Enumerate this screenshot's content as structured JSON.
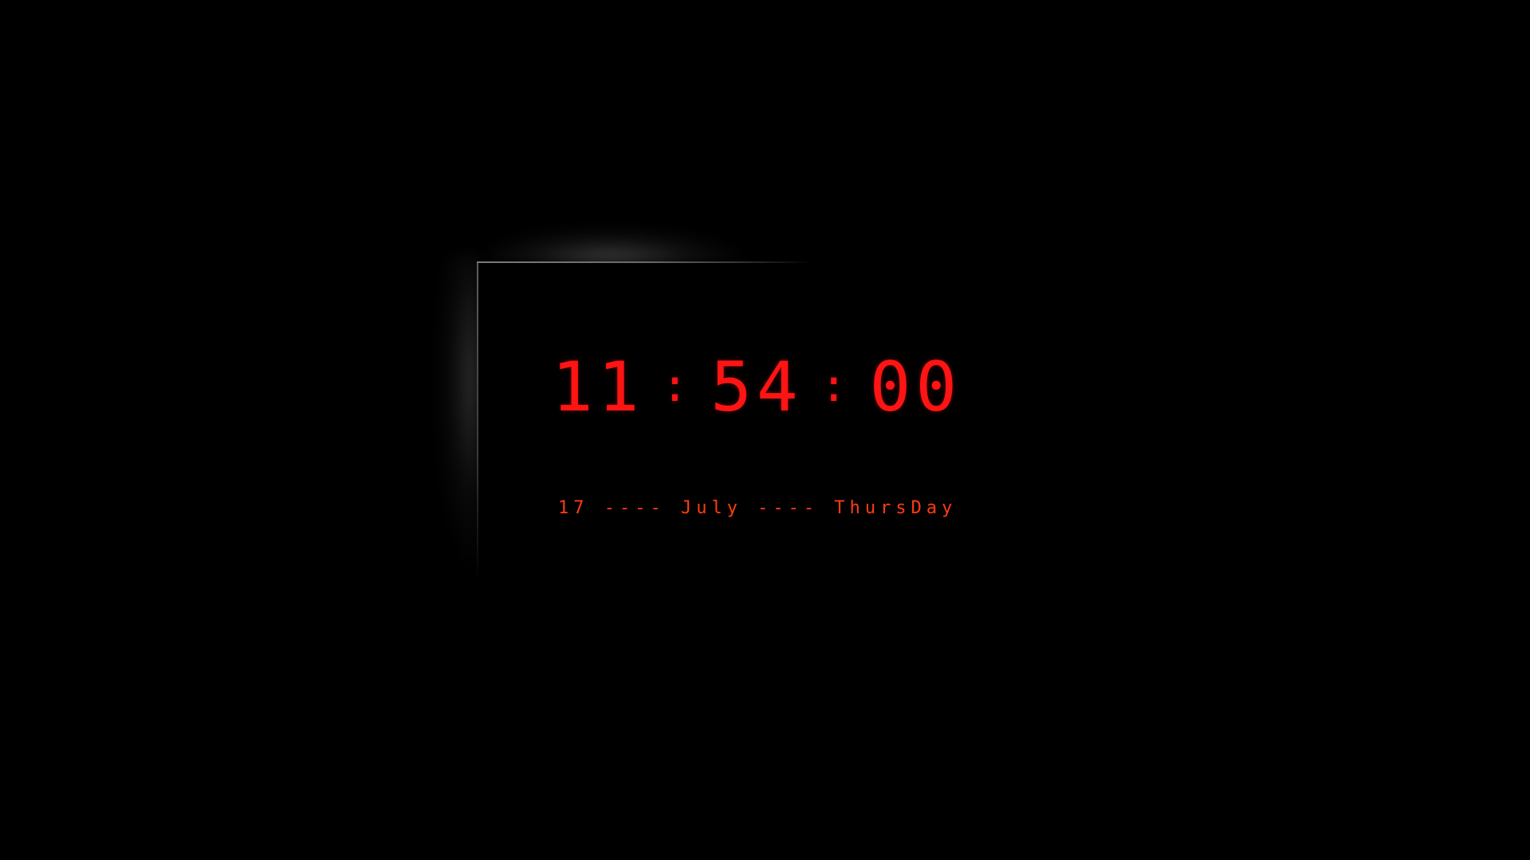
{
  "clock": {
    "hours": "11",
    "minutes": "54",
    "seconds": "00",
    "separator": ":"
  },
  "date": {
    "text": "17 ---- July ---- ThursDay"
  },
  "colors": {
    "background": "#000000",
    "time": "#ff1414",
    "date": "#ff3c10",
    "frame": "#6a6a6a"
  }
}
